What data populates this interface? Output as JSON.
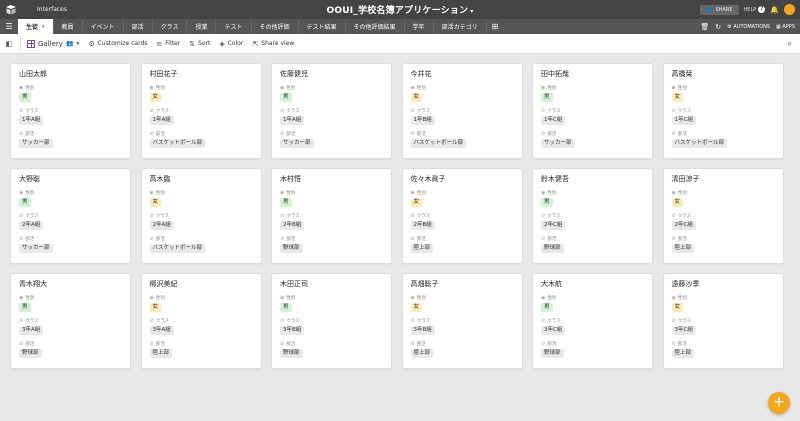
{
  "topbar": {
    "interfaces_label": "Interfaces",
    "app_title": "OOUI_学校名簿アプリケーション",
    "share_label": "SHARE",
    "help_label": "HELP"
  },
  "tabs": [
    {
      "label": "生徒"
    },
    {
      "label": "教員"
    },
    {
      "label": "イベント"
    },
    {
      "label": "部活"
    },
    {
      "label": "クラス"
    },
    {
      "label": "授業"
    },
    {
      "label": "テスト"
    },
    {
      "label": "その他評価"
    },
    {
      "label": "テスト結果"
    },
    {
      "label": "その他評価結果"
    },
    {
      "label": "学年"
    },
    {
      "label": "部活カテゴリ"
    }
  ],
  "tabbar_right": {
    "automations_label": "AUTOMATIONS",
    "apps_label": "APPS"
  },
  "viewbar": {
    "gallery_label": "Gallery",
    "customize_label": "Customize cards",
    "filter_label": "Filter",
    "sort_label": "Sort",
    "color_label": "Color",
    "share_view_label": "Share view"
  },
  "field_labels": {
    "gender": "性別",
    "class": "クラス",
    "club": "部活"
  },
  "cards": [
    {
      "name": "山田太郎",
      "gender": "男",
      "class": "1年A組",
      "club": "サッカー部"
    },
    {
      "name": "村田花子",
      "gender": "女",
      "class": "1年A組",
      "club": "バスケットボール部"
    },
    {
      "name": "佐藤健児",
      "gender": "男",
      "class": "1年A組",
      "club": "サッカー部"
    },
    {
      "name": "今井花",
      "gender": "女",
      "class": "1年B組",
      "club": "バスケットボール部"
    },
    {
      "name": "田中拓哉",
      "gender": "男",
      "class": "1年C組",
      "club": "サッカー部"
    },
    {
      "name": "高橋栞",
      "gender": "女",
      "class": "1年C組",
      "club": "バスケットボール部"
    },
    {
      "name": "大野聡",
      "gender": "男",
      "class": "2年A組",
      "club": "サッカー部"
    },
    {
      "name": "高木臨",
      "gender": "女",
      "class": "2年A組",
      "club": "バスケットボール部"
    },
    {
      "name": "木村悟",
      "gender": "男",
      "class": "2年B組",
      "club": "野球部"
    },
    {
      "name": "佐々木眞子",
      "gender": "女",
      "class": "2年B組",
      "club": "陸上部"
    },
    {
      "name": "鈴木健吾",
      "gender": "男",
      "class": "2年C組",
      "club": "野球部"
    },
    {
      "name": "清田涼子",
      "gender": "女",
      "class": "2年C組",
      "club": "陸上部"
    },
    {
      "name": "青木翔大",
      "gender": "男",
      "class": "3年A組",
      "club": "野球部"
    },
    {
      "name": "柳沢美紀",
      "gender": "女",
      "class": "3年A組",
      "club": "陸上部"
    },
    {
      "name": "木田正司",
      "gender": "男",
      "class": "3年B組",
      "club": "野球部"
    },
    {
      "name": "高畑聡子",
      "gender": "女",
      "class": "3年B組",
      "club": "陸上部"
    },
    {
      "name": "大木航",
      "gender": "男",
      "class": "3年C組",
      "club": "野球部"
    },
    {
      "name": "遠藤沙季",
      "gender": "女",
      "class": "3年C組",
      "club": "陸上部"
    }
  ],
  "colors": {
    "topbar_bg": "#444444",
    "tabbar_bg": "#555555",
    "male_pill": "#cff5d1",
    "female_pill": "#ffeab6",
    "fab": "#f2a71d",
    "gallery_icon": "#6a46c8"
  },
  "icons": {
    "logo": "airtable-logo-icon",
    "menu": "hamburger-menu-icon",
    "add_tab": "plus-icon",
    "add_record": "plus-icon"
  }
}
